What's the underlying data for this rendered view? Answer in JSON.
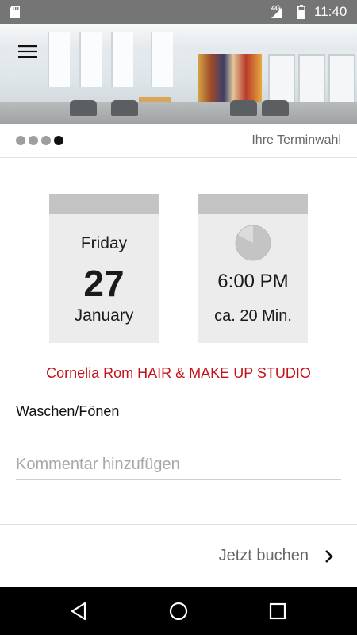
{
  "status_bar": {
    "network_label": "4G",
    "time": "11:40"
  },
  "header": {
    "menu_icon": "hamburger-menu-icon"
  },
  "steps": {
    "total": 4,
    "current": 4,
    "title": "Ihre Terminwahl"
  },
  "appointment": {
    "date": {
      "weekday": "Friday",
      "day": "27",
      "month": "January"
    },
    "time": {
      "icon": "clock-icon",
      "value": "6:00 PM",
      "duration": "ca. 20 Min."
    },
    "salon": "Cornelia Rom HAIR & MAKE UP STUDIO",
    "service": "Waschen/Fönen"
  },
  "comment": {
    "placeholder": "Kommentar hinzufügen",
    "value": ""
  },
  "actions": {
    "book_label": "Jetzt buchen",
    "book_icon": "chevron-right-icon"
  },
  "colors": {
    "accent": "#c4121a",
    "status_bar": "#757575",
    "card_background": "#ececec",
    "card_header": "#c4c4c4"
  }
}
